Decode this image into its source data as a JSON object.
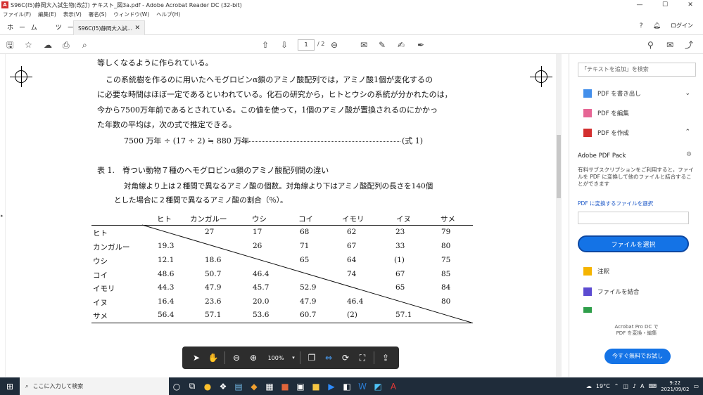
{
  "window": {
    "title": "S96C(I5)静岡大入試生物(改訂) テキスト_図3a.pdf - Adobe Acrobat Reader DC (32-bit)",
    "min": "—",
    "max": "☐",
    "close": "✕"
  },
  "menu": [
    "ファイル(F)",
    "編集(E)",
    "表示(V)",
    "署名(S)",
    "ウィンドウ(W)",
    "ヘルプ(H)"
  ],
  "tabs": {
    "home": "ホーム",
    "tools": "ツール",
    "doc": "S96C(I5)静岡大入試...",
    "signin": "ログイン"
  },
  "toolbar": {
    "page_current": "1",
    "page_total": "/ 2"
  },
  "doc": {
    "line1": "等しくなるように作られている。",
    "line2": "この系統樹を作るのに用いたヘモグロビンα鎖のアミノ酸配列では，アミノ酸1個が変化するの",
    "line3": "に必要な時間はほぼ一定であるといわれている。化石の研究から，ヒトとウシの系統が分かれたのは，",
    "line4": "今から7500万年前であるとされている。この値を使って，1個のアミノ酸が置換されるのにかかっ",
    "line5": "た年数の平均は，次の式で推定できる。",
    "formula": "7500 万年 ÷ (17 ÷ 2) ≒ 880 万年",
    "formula_tag": "(式 1)",
    "table_title": "表 1.　脊つい動物７種のヘモグロビンα鎖のアミノ酸配列間の違い",
    "table_desc1": "対角線より上は２種間で異なるアミノ酸の個数。対角線より下はアミノ酸配列の長さを140個",
    "table_desc2": "とした場合に２種間で異なるアミノ酸の割合（％）。",
    "columns": [
      "ヒト",
      "カンガルー",
      "ウシ",
      "コイ",
      "イモリ",
      "イヌ",
      "サメ"
    ],
    "rows": [
      {
        "name": "ヒト",
        "cells": [
          "",
          "27",
          "17",
          "68",
          "62",
          "23",
          "79"
        ]
      },
      {
        "name": "カンガルー",
        "cells": [
          "19.3",
          "",
          "26",
          "71",
          "67",
          "33",
          "80"
        ]
      },
      {
        "name": "ウシ",
        "cells": [
          "12.1",
          "18.6",
          "",
          "65",
          "64",
          "(1)",
          "75"
        ]
      },
      {
        "name": "コイ",
        "cells": [
          "48.6",
          "50.7",
          "46.4",
          "",
          "74",
          "67",
          "85"
        ]
      },
      {
        "name": "イモリ",
        "cells": [
          "44.3",
          "47.9",
          "45.7",
          "52.9",
          "",
          "65",
          "84"
        ]
      },
      {
        "name": "イヌ",
        "cells": [
          "16.4",
          "23.6",
          "20.0",
          "47.9",
          "46.4",
          "",
          "80"
        ]
      },
      {
        "name": "サメ",
        "cells": [
          "56.4",
          "57.1",
          "53.6",
          "60.7",
          "(2)",
          "57.1",
          ""
        ]
      }
    ]
  },
  "rpanel": {
    "search": "「テキストを追加」を検索",
    "export_pdf": "PDF を書き出し",
    "edit_pdf": "PDF を編集",
    "create_pdf": "PDF を作成",
    "pack_title": "Adobe PDF Pack",
    "pack_desc": "有料サブスクリプションをご利用すると，ファイルを PDF に変換して他のファイルと結合することができます",
    "convert_link": "PDF に変換するファイルを選択",
    "select_file": "ファイルを選択",
    "comment": "注釈",
    "combine": "ファイルを結合",
    "footer": "Acrobat Pro DC で\nPDF を変換・編集",
    "trial": "今すぐ無料でお試し"
  },
  "floatbar": {
    "zoom": "100%"
  },
  "taskbar": {
    "search": "ここに入力して検索",
    "temp": "19°C",
    "ime": "A",
    "time": "9:22",
    "date": "2021/09/02"
  }
}
